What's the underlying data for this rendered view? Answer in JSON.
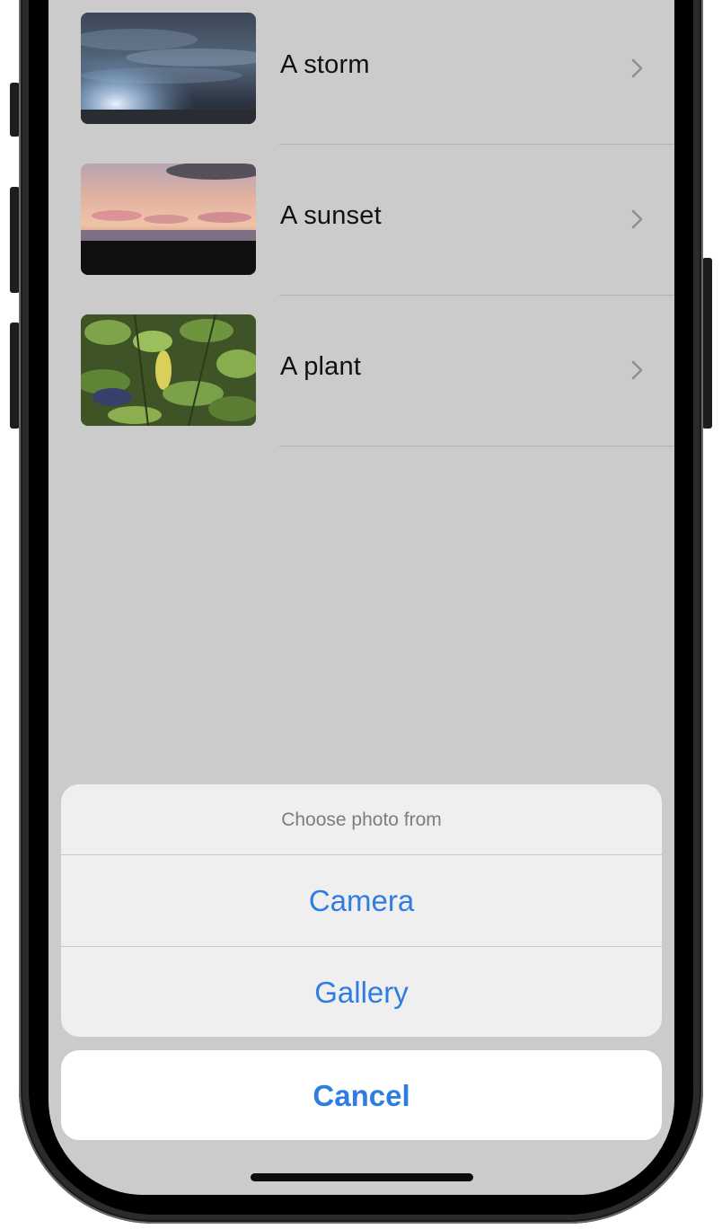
{
  "list": {
    "items": [
      {
        "title": "A storm",
        "thumbnail_icon": "storm-photo"
      },
      {
        "title": "A sunset",
        "thumbnail_icon": "sunset-photo"
      },
      {
        "title": "A plant",
        "thumbnail_icon": "plant-photo"
      }
    ],
    "chevron_icon": "chevron-right-icon"
  },
  "action_sheet": {
    "title": "Choose photo from",
    "options": [
      {
        "label": "Camera"
      },
      {
        "label": "Gallery"
      }
    ],
    "cancel_label": "Cancel"
  },
  "colors": {
    "accent": "#2f7de1",
    "screen_dim_background": "#cbcbcb",
    "sheet_background": "#efefef",
    "cancel_background": "#ffffff"
  }
}
